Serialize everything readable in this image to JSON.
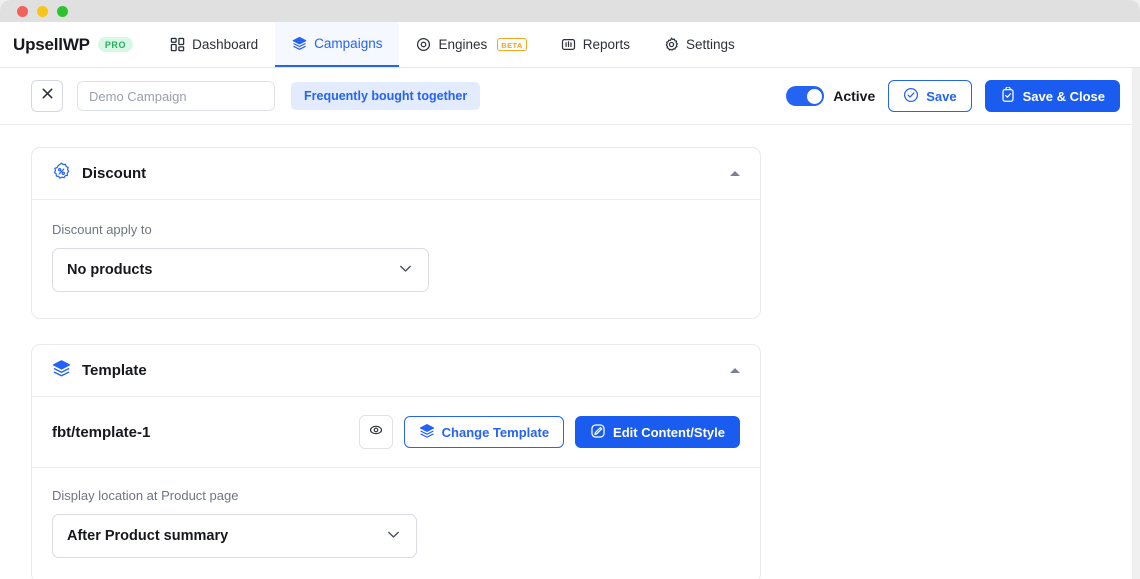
{
  "window": {
    "traffic_lights": [
      "close",
      "minimize",
      "maximize"
    ]
  },
  "topnav": {
    "brand": "UpsellWP",
    "brand_badge": "PRO",
    "items": [
      {
        "label": "Dashboard",
        "icon": "grid-icon",
        "active": false
      },
      {
        "label": "Campaigns",
        "icon": "layers-icon",
        "active": true
      },
      {
        "label": "Engines",
        "icon": "target-icon",
        "badge": "BETA",
        "active": false
      },
      {
        "label": "Reports",
        "icon": "bar-chart-icon",
        "active": false
      },
      {
        "label": "Settings",
        "icon": "gear-icon",
        "active": false
      }
    ]
  },
  "toolbar": {
    "close_icon": "close-icon",
    "campaign_name_value": "",
    "campaign_name_placeholder": "Demo Campaign",
    "campaign_type": "Frequently bought together",
    "status_label": "Active",
    "status_on": true,
    "save_label": "Save",
    "save_close_label": "Save & Close"
  },
  "cards": {
    "discount": {
      "title": "Discount",
      "icon": "discount-badge-icon",
      "field_label": "Discount apply to",
      "select_value": "No products"
    },
    "template": {
      "title": "Template",
      "icon": "layers-icon",
      "template_name": "fbt/template-1",
      "preview_icon": "eye-icon",
      "change_template_label": "Change Template",
      "edit_content_label": "Edit Content/Style",
      "display_location_label": "Display location at Product page",
      "display_location_value": "After Product summary"
    }
  },
  "colors": {
    "accent_blue": "#2563f5",
    "primary_button": "#1a5cf0",
    "badge_bg": "#e3ecfe",
    "pro_green": "#25ae63",
    "beta_orange": "#f5a623"
  }
}
